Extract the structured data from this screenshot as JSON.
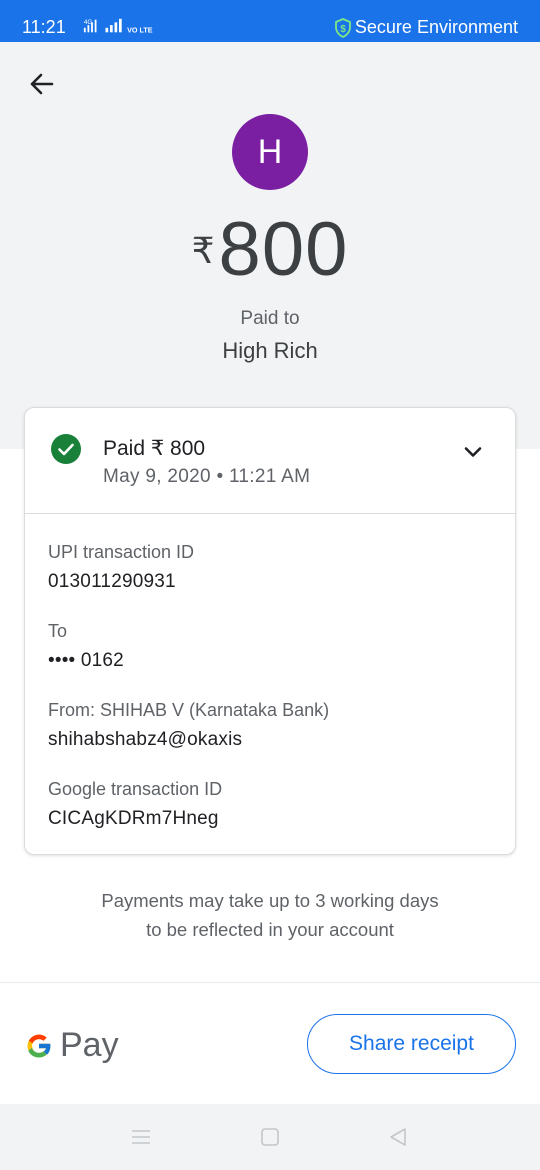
{
  "status_bar": {
    "time": "11:21",
    "network_label": "4G",
    "volte_label": "VO LTE",
    "secure_label": "Secure Environment"
  },
  "header": {
    "avatar_initial": "H",
    "currency_symbol": "₹",
    "amount": "800",
    "paid_to_label": "Paid to",
    "payee_name": "High Rich"
  },
  "summary": {
    "status": "Paid ₹ 800",
    "datetime": "May 9, 2020 • 11:21 AM"
  },
  "details": [
    {
      "label": "UPI transaction ID",
      "value": "013011290931"
    },
    {
      "label": "To",
      "value": "•••• 0162"
    },
    {
      "label": "From: SHIHAB V (Karnataka Bank)",
      "value": "shihabshabz4@okaxis"
    },
    {
      "label": "Google transaction ID",
      "value": "CICAgKDRm7Hneg"
    }
  ],
  "notice": {
    "line1": "Payments may take up to 3 working days",
    "line2": "to be reflected in your account"
  },
  "footer": {
    "brand_text": "Pay",
    "share_label": "Share receipt"
  },
  "colors": {
    "status_bar": "#1a73e8",
    "avatar": "#7b1fa2",
    "success": "#188038",
    "accent": "#1a73e8"
  }
}
